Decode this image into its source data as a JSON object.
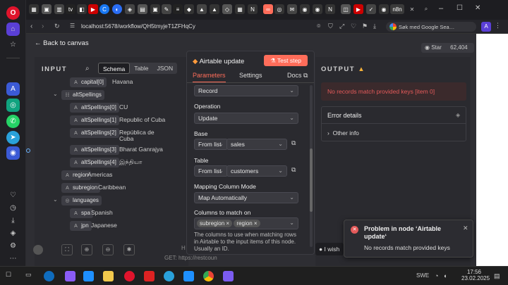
{
  "opera_sidebar": {
    "logo": "O"
  },
  "browser": {
    "url": "localhost:5678/workflow/QH5tmyjeT1ZFHqCy",
    "search_placeholder": "Søk med Google Sea…",
    "window_controls": [
      "–",
      "☐",
      "✕"
    ]
  },
  "header": {
    "back_label": "Back to canvas",
    "star_label": "Star",
    "star_count": "62,404"
  },
  "input_panel": {
    "title": "INPUT",
    "view_tabs": [
      "Schema",
      "Table",
      "JSON"
    ],
    "tree": [
      {
        "key": "capital[0]",
        "value": "Havana",
        "type": "A",
        "level": 3
      },
      {
        "key": "altSpellings",
        "value": "",
        "type": "list",
        "level": 2
      },
      {
        "key": "altSpellings[0]",
        "value": "CU",
        "type": "A",
        "level": 3
      },
      {
        "key": "altSpellings[1]",
        "value": "Republic of Cuba",
        "type": "A",
        "level": 3
      },
      {
        "key": "altSpellings[2]",
        "value": "República de Cuba",
        "type": "A",
        "level": 3
      },
      {
        "key": "altSpellings[3]",
        "value": "Bharat Ganrajya",
        "type": "A",
        "level": 3
      },
      {
        "key": "altSpellings[4]",
        "value": "இந்தியா",
        "type": "A",
        "level": 3
      },
      {
        "key": "region",
        "value": "Americas",
        "type": "A",
        "level": 2
      },
      {
        "key": "subregion",
        "value": "Caribbean",
        "type": "A",
        "level": 2
      },
      {
        "key": "languages",
        "value": "",
        "type": "obj",
        "level": 2
      },
      {
        "key": "spa",
        "value": "Spanish",
        "type": "A",
        "level": 3
      },
      {
        "key": "jpn",
        "value": "Japanese",
        "type": "A",
        "level": 3
      }
    ],
    "partial_text_1": "H",
    "partial_text_2": "GET: https://restcoun"
  },
  "node": {
    "title": "Airtable update",
    "test_button": "Test step",
    "tabs": [
      "Parameters",
      "Settings"
    ],
    "docs_label": "Docs",
    "resource_value": "Record",
    "operation_label": "Operation",
    "operation_value": "Update",
    "base_label": "Base",
    "base_mode": "From list",
    "base_value": "sales",
    "table_label": "Table",
    "table_mode": "From list",
    "table_value": "customers",
    "mapping_label": "Mapping Column Mode",
    "mapping_value": "Map Automatically",
    "columns_label": "Columns to match on",
    "columns_chips": [
      "subregion",
      "region"
    ],
    "columns_hint": "The columns to use when matching rows in Airtable to the input items of this node. Usually an ID."
  },
  "output_panel": {
    "title": "OUTPUT",
    "error_banner": "No records match provided keys [item 0]",
    "details_title": "Error details",
    "other_info": "Other info",
    "wish_label": "I wish"
  },
  "toast": {
    "title": "Problem in node ‘Airtable update‘",
    "message": "No records match provided keys"
  },
  "taskbar": {
    "language": "SWE",
    "time": "17:56",
    "date": "23.02.2025"
  },
  "colors": {
    "accent": "#ff6d5a",
    "error": "#e45a5a",
    "error_bg": "#3b2a2c",
    "bg": "#2e2e33"
  }
}
